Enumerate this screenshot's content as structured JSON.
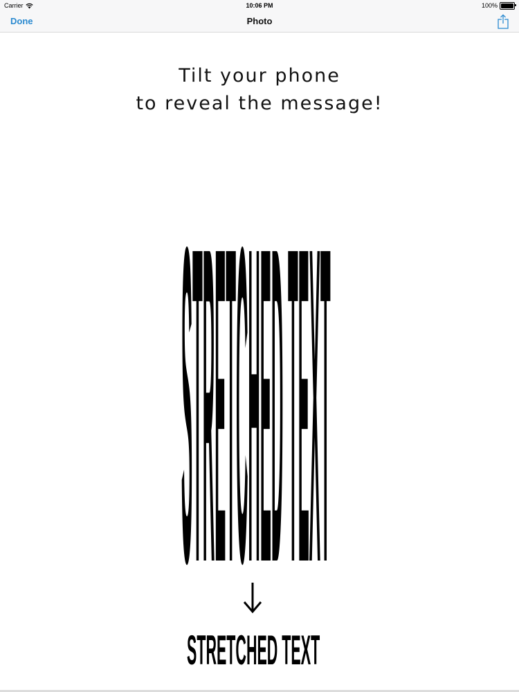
{
  "status_bar": {
    "carrier": "Carrier",
    "time": "10:06 PM",
    "battery": "100%",
    "battery_level": 1.0,
    "wifi_icon": "wifi-icon",
    "battery_icon": "battery-icon"
  },
  "nav": {
    "done_label": "Done",
    "title": "Photo",
    "share_icon": "share-icon"
  },
  "photo": {
    "caption_line1": "Tilt your phone",
    "caption_line2": "to reveal the message!",
    "stretched_text": "STRETCHED TEXT",
    "arrow_icon": "arrow-down-icon",
    "result_text": "STRETCHED TEXT"
  },
  "colors": {
    "accent": "#2b8ad0",
    "bar_background": "#f7f7f8",
    "text": "#000000"
  }
}
